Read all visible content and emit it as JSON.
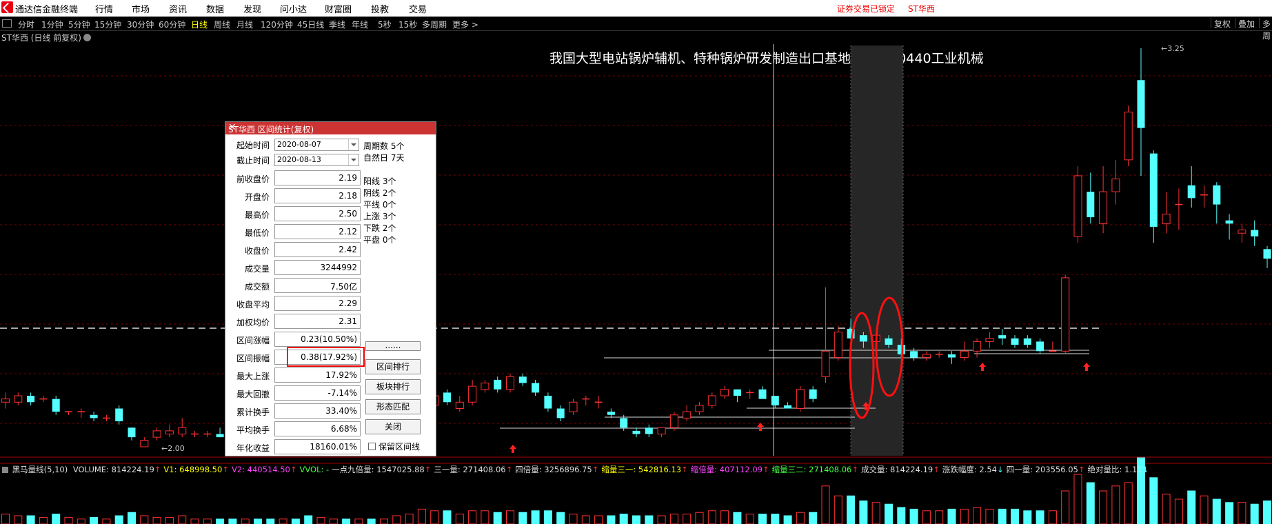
{
  "menubar": {
    "app_name": "通达信金融终端",
    "menus": [
      "行情",
      "市场",
      "资讯",
      "数据",
      "发现",
      "问小达",
      "财富圈",
      "投教",
      "交易"
    ],
    "status_locked": "证券交易已锁定",
    "status_stock": "ST华西"
  },
  "periods": [
    "分时",
    "1分钟",
    "5分钟",
    "15分钟",
    "30分钟",
    "60分钟",
    "日线",
    "周线",
    "月线",
    "120分钟",
    "45日线",
    "季线",
    "年线",
    "5秒",
    "15秒",
    "多周期",
    "更多 >"
  ],
  "active_period": "日线",
  "right_buttons": [
    "复权",
    "叠加",
    "多周"
  ],
  "chart_header": {
    "stock_label": "ST华西 (日线 前复权)",
    "concept_title": "我国大型电站锅炉辅机、特种锅炉研发制造出口基地之一  880440工业机械",
    "high_label": "3.25",
    "low_label": "2.00"
  },
  "colors": {
    "up": "#ff3232",
    "down": "#54ffff",
    "bg": "#000000",
    "accent": "#e60012"
  },
  "dialog": {
    "title": "ST华西 区间统计(复权)",
    "start_label": "起始时间",
    "start_value": "2020-08-07",
    "end_label": "截止时间",
    "end_value": "2020-08-13",
    "rows": [
      {
        "label": "前收盘价",
        "value": "2.19"
      },
      {
        "label": "开盘价",
        "value": "2.18"
      },
      {
        "label": "最高价",
        "value": "2.50"
      },
      {
        "label": "最低价",
        "value": "2.12"
      },
      {
        "label": "收盘价",
        "value": "2.42"
      },
      {
        "label": "成交量",
        "value": "3244992"
      },
      {
        "label": "成交额",
        "value": "7.50亿"
      },
      {
        "label": "收盘平均",
        "value": "2.29"
      },
      {
        "label": "加权均价",
        "value": "2.31"
      },
      {
        "label": "区间涨幅",
        "value": "0.23(10.50%)"
      },
      {
        "label": "区间振幅",
        "value": "0.38(17.92%)"
      },
      {
        "label": "最大上涨",
        "value": "17.92%"
      },
      {
        "label": "最大回撤",
        "value": "-7.14%"
      },
      {
        "label": "累计换手",
        "value": "33.40%"
      },
      {
        "label": "平均换手",
        "value": "6.68%"
      },
      {
        "label": "年化收益",
        "value": "18160.01%"
      }
    ],
    "stats": [
      "周期数 5个",
      "自然日 7天",
      "阳线 3个",
      "阴线 2个",
      "平线 0个",
      "上涨 3个",
      "下跌 2个",
      "平盘 0个"
    ],
    "buttons": [
      "......",
      "区间排行",
      "板块排行",
      "形态匹配",
      "关闭"
    ],
    "keep_line_label": "保留区间线"
  },
  "indicator": {
    "name": "黑马量线(5,10)",
    "items": [
      {
        "text": "VOLUME: 814224.19",
        "arrow": "↑",
        "color": "#dddddd"
      },
      {
        "text": "V1: 648998.50",
        "arrow": "↑",
        "color": "#ffff00"
      },
      {
        "text": "V2: 440514.50",
        "arrow": "↑",
        "color": "#ff44ff"
      },
      {
        "text": "VVOL: -",
        "arrow": "",
        "color": "#44ff44"
      },
      {
        "text": "一点九倍量: 1547025.88",
        "arrow": "↑",
        "color": "#dddddd"
      },
      {
        "text": "三一量: 271408.06",
        "arrow": "↑",
        "color": "#dddddd"
      },
      {
        "text": "四倍量: 3256896.75",
        "arrow": "↑",
        "color": "#dddddd"
      },
      {
        "text": "缩量三一: 542816.13",
        "arrow": "↑",
        "color": "#ffff00"
      },
      {
        "text": "缩倍量: 407112.09",
        "arrow": "↑",
        "color": "#ff44ff"
      },
      {
        "text": "缩量三二: 271408.06",
        "arrow": "↑",
        "color": "#44ff44"
      },
      {
        "text": "成交量: 814224.19",
        "arrow": "↑",
        "color": "#dddddd"
      },
      {
        "text": "涨跌幅度: 2.54",
        "arrow": "↓",
        "color": "#dddddd"
      },
      {
        "text": "四一量: 203556.05",
        "arrow": "↑",
        "color": "#dddddd"
      },
      {
        "text": "绝对量比: 1.11",
        "arrow": "↓",
        "color": "#dddddd"
      }
    ]
  },
  "chart_data": {
    "type": "candlestick",
    "price_high_label": 3.25,
    "price_low_label": 2.0,
    "bars": [
      [
        2.14,
        2.15,
        2.12,
        2.17
      ],
      [
        2.14,
        2.16,
        2.13,
        2.17
      ],
      [
        2.16,
        2.14,
        2.13,
        2.17
      ],
      [
        2.15,
        2.15,
        2.14,
        2.16
      ],
      [
        2.15,
        2.11,
        2.1,
        2.16
      ],
      [
        2.11,
        2.11,
        2.1,
        2.11
      ],
      [
        2.11,
        2.11,
        2.09,
        2.12
      ],
      [
        2.1,
        2.09,
        2.08,
        2.11
      ],
      [
        2.09,
        2.09,
        2.08,
        2.1
      ],
      [
        2.12,
        2.08,
        2.07,
        2.13
      ],
      [
        2.06,
        2.03,
        2.02,
        2.06
      ],
      [
        2.0,
        2.02,
        2.0,
        2.03
      ],
      [
        2.03,
        2.05,
        2.02,
        2.06
      ],
      [
        2.04,
        2.05,
        2.03,
        2.07
      ],
      [
        2.04,
        2.06,
        2.03,
        2.09
      ],
      [
        2.04,
        2.04,
        2.03,
        2.05
      ],
      [
        2.04,
        2.04,
        2.03,
        2.05
      ],
      [
        2.04,
        2.03,
        2.03,
        2.06
      ],
      [
        2.03,
        2.02,
        2.02,
        2.04
      ],
      [
        2.03,
        2.03,
        2.02,
        2.03
      ],
      [
        2.04,
        2.03,
        2.02,
        2.05
      ],
      [
        2.03,
        2.02,
        2.01,
        2.04
      ],
      [
        2.03,
        2.03,
        2.02,
        2.05
      ],
      [
        2.03,
        2.02,
        2.01,
        2.04
      ],
      [
        2.02,
        2.0,
        1.99,
        2.03
      ],
      [
        2.02,
        2.03,
        2.01,
        2.05
      ],
      [
        2.02,
        2.03,
        2.01,
        2.03
      ],
      [
        2.03,
        2.02,
        2.01,
        2.04
      ],
      [
        2.03,
        2.03,
        2.02,
        2.04
      ],
      [
        2.03,
        2.02,
        2.01,
        2.03
      ],
      [
        2.01,
        2.01,
        2.0,
        2.02
      ],
      [
        2.0,
        2.03,
        1.99,
        2.05
      ],
      [
        2.04,
        2.06,
        2.03,
        2.07
      ],
      [
        2.07,
        2.14,
        2.06,
        2.15
      ],
      [
        2.13,
        2.16,
        2.11,
        2.17
      ],
      [
        2.17,
        2.14,
        2.13,
        2.18
      ],
      [
        2.12,
        2.14,
        2.11,
        2.16
      ],
      [
        2.14,
        2.19,
        2.13,
        2.21
      ],
      [
        2.18,
        2.2,
        2.17,
        2.21
      ],
      [
        2.21,
        2.18,
        2.17,
        2.22
      ],
      [
        2.18,
        2.22,
        2.17,
        2.23
      ],
      [
        2.22,
        2.2,
        2.19,
        2.23
      ],
      [
        2.2,
        2.17,
        2.16,
        2.21
      ],
      [
        2.16,
        2.12,
        2.11,
        2.17
      ],
      [
        2.12,
        2.09,
        2.08,
        2.13
      ],
      [
        2.11,
        2.14,
        2.1,
        2.15
      ],
      [
        2.15,
        2.15,
        2.13,
        2.16
      ],
      [
        2.14,
        2.14,
        2.12,
        2.16
      ],
      [
        2.11,
        2.1,
        2.09,
        2.12
      ],
      [
        2.09,
        2.06,
        2.05,
        2.1
      ],
      [
        2.05,
        2.04,
        2.03,
        2.06
      ],
      [
        2.06,
        2.04,
        2.03,
        2.07
      ],
      [
        2.04,
        2.06,
        2.03,
        2.06
      ],
      [
        2.06,
        2.1,
        2.05,
        2.11
      ],
      [
        2.09,
        2.11,
        2.08,
        2.13
      ],
      [
        2.11,
        2.13,
        2.1,
        2.14
      ],
      [
        2.13,
        2.16,
        2.12,
        2.17
      ],
      [
        2.16,
        2.18,
        2.15,
        2.19
      ],
      [
        2.18,
        2.16,
        2.14,
        2.18
      ],
      [
        2.17,
        2.17,
        2.15,
        2.18
      ],
      [
        2.18,
        2.15,
        2.15,
        2.19
      ],
      [
        2.16,
        2.13,
        2.12,
        2.16
      ],
      [
        2.13,
        2.12,
        2.12,
        2.14
      ],
      [
        2.12,
        2.18,
        2.11,
        2.19
      ],
      [
        2.18,
        2.15,
        2.14,
        2.19
      ],
      [
        2.22,
        2.3,
        2.2,
        2.5
      ],
      [
        2.28,
        2.36,
        2.27,
        2.38
      ],
      [
        2.37,
        2.34,
        2.32,
        2.4
      ],
      [
        2.35,
        2.33,
        2.31,
        2.36
      ],
      [
        2.33,
        2.35,
        2.31,
        2.36
      ],
      [
        2.34,
        2.32,
        2.31,
        2.35
      ],
      [
        2.32,
        2.29,
        2.28,
        2.34
      ],
      [
        2.3,
        2.28,
        2.27,
        2.31
      ],
      [
        2.28,
        2.29,
        2.27,
        2.3
      ],
      [
        2.29,
        2.29,
        2.28,
        2.3
      ],
      [
        2.29,
        2.28,
        2.26,
        2.3
      ],
      [
        2.28,
        2.3,
        2.27,
        2.33
      ],
      [
        2.3,
        2.33,
        2.28,
        2.34
      ],
      [
        2.33,
        2.34,
        2.31,
        2.36
      ],
      [
        2.35,
        2.34,
        2.32,
        2.37
      ],
      [
        2.34,
        2.32,
        2.31,
        2.35
      ],
      [
        2.34,
        2.32,
        2.31,
        2.35
      ],
      [
        2.33,
        2.3,
        2.29,
        2.34
      ],
      [
        2.3,
        2.3,
        2.3,
        2.33
      ],
      [
        2.3,
        2.53,
        2.29,
        2.54
      ],
      [
        2.66,
        2.85,
        2.64,
        2.88
      ],
      [
        2.8,
        2.72,
        2.7,
        2.86
      ],
      [
        2.7,
        2.8,
        2.67,
        2.88
      ],
      [
        2.8,
        2.84,
        2.76,
        2.9
      ],
      [
        2.9,
        3.05,
        2.88,
        3.07
      ],
      [
        3.15,
        3.0,
        2.85,
        3.25
      ],
      [
        2.92,
        2.69,
        2.64,
        2.93
      ],
      [
        2.7,
        2.73,
        2.67,
        2.8
      ],
      [
        2.76,
        2.76,
        2.68,
        2.81
      ],
      [
        2.82,
        2.78,
        2.75,
        2.88
      ],
      [
        2.79,
        2.79,
        2.75,
        2.82
      ],
      [
        2.82,
        2.76,
        2.7,
        2.83
      ],
      [
        2.71,
        2.7,
        2.65,
        2.73
      ],
      [
        2.67,
        2.68,
        2.64,
        2.7
      ],
      [
        2.68,
        2.66,
        2.63,
        2.71
      ],
      [
        2.62,
        2.59,
        2.56,
        2.63
      ]
    ],
    "volume": [
      0.6,
      0.5,
      0.5,
      0.4,
      0.6,
      0.4,
      0.3,
      0.4,
      0.3,
      0.5,
      0.7,
      0.5,
      0.4,
      0.4,
      0.5,
      0.3,
      0.3,
      0.3,
      0.3,
      0.3,
      0.3,
      0.3,
      0.3,
      0.3,
      0.5,
      0.4,
      0.3,
      0.3,
      0.3,
      0.3,
      0.3,
      0.5,
      0.6,
      0.9,
      0.8,
      0.8,
      0.6,
      0.8,
      0.8,
      0.7,
      0.8,
      0.7,
      0.8,
      0.8,
      0.7,
      0.6,
      0.5,
      0.5,
      0.5,
      0.6,
      0.5,
      0.5,
      0.5,
      0.6,
      0.6,
      0.7,
      0.8,
      0.8,
      0.7,
      0.6,
      0.6,
      0.6,
      0.5,
      0.7,
      0.7,
      2.3,
      1.7,
      1.7,
      1.4,
      1.3,
      1.2,
      1.0,
      0.9,
      0.8,
      0.8,
      0.9,
      0.9,
      1.0,
      0.9,
      0.9,
      0.9,
      0.8,
      0.8,
      0.8,
      2.0,
      3.0,
      2.5,
      2.0,
      2.3,
      2.5,
      4.0,
      2.8,
      1.8,
      1.5,
      2.0,
      1.7,
      1.5,
      1.3,
      1.3,
      1.2,
      1.4
    ]
  }
}
